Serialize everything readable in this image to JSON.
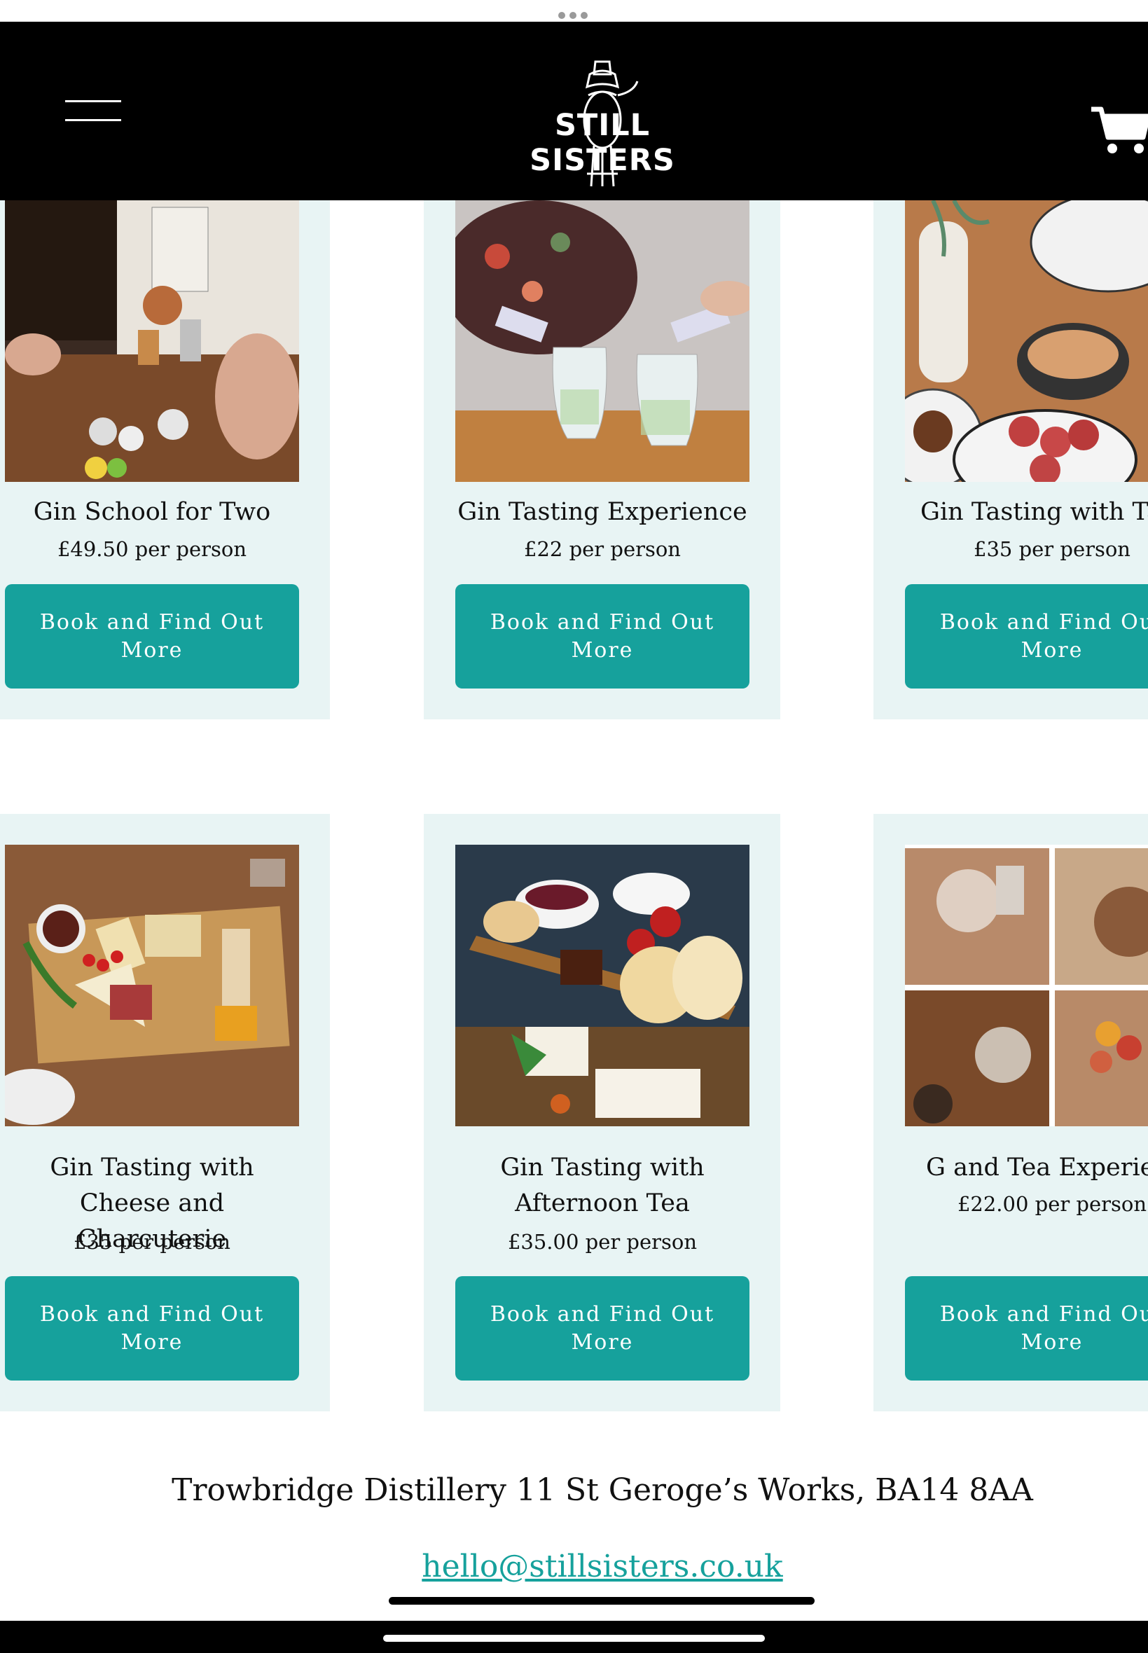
{
  "header": {
    "logo_text": "STILL SISTERS",
    "menu_icon": "hamburger-menu-icon",
    "cart_icon": "shopping-cart-icon"
  },
  "colors": {
    "accent": "#16a19c",
    "card_background": "#e8f4f4",
    "header_background": "#000000"
  },
  "experiences": [
    {
      "title": "Gin School for Two",
      "price": "£49.50 per person",
      "button": "Book and Find Out More",
      "image": "gin-school-photo"
    },
    {
      "title": "Gin Tasting Experience",
      "price": "£22 per person",
      "button": "Book and Find Out More",
      "image": "gin-pouring-photo"
    },
    {
      "title": "Gin Tasting with Tap",
      "price": "£35 per person",
      "button": "Book and Find Out More",
      "image": "tapas-photo"
    },
    {
      "title": "Gin Tasting with Cheese and Charcuterie",
      "price": "£35 per person",
      "button": "Book and Find Out More",
      "image": "cheese-board-photo"
    },
    {
      "title": "Gin Tasting with Afternoon Tea",
      "price": "£35.00 per person",
      "button": "Book and Find Out More",
      "image": "afternoon-tea-photo"
    },
    {
      "title": "G and Tea Experien",
      "price": "£22.00 per person",
      "button": "Book and Find Out More",
      "image": "tea-collage-photo"
    }
  ],
  "footer": {
    "address": "Trowbridge Distillery 11 St Geroge’s Works, BA14 8AA",
    "email": "hello@stillsisters.co.uk"
  }
}
